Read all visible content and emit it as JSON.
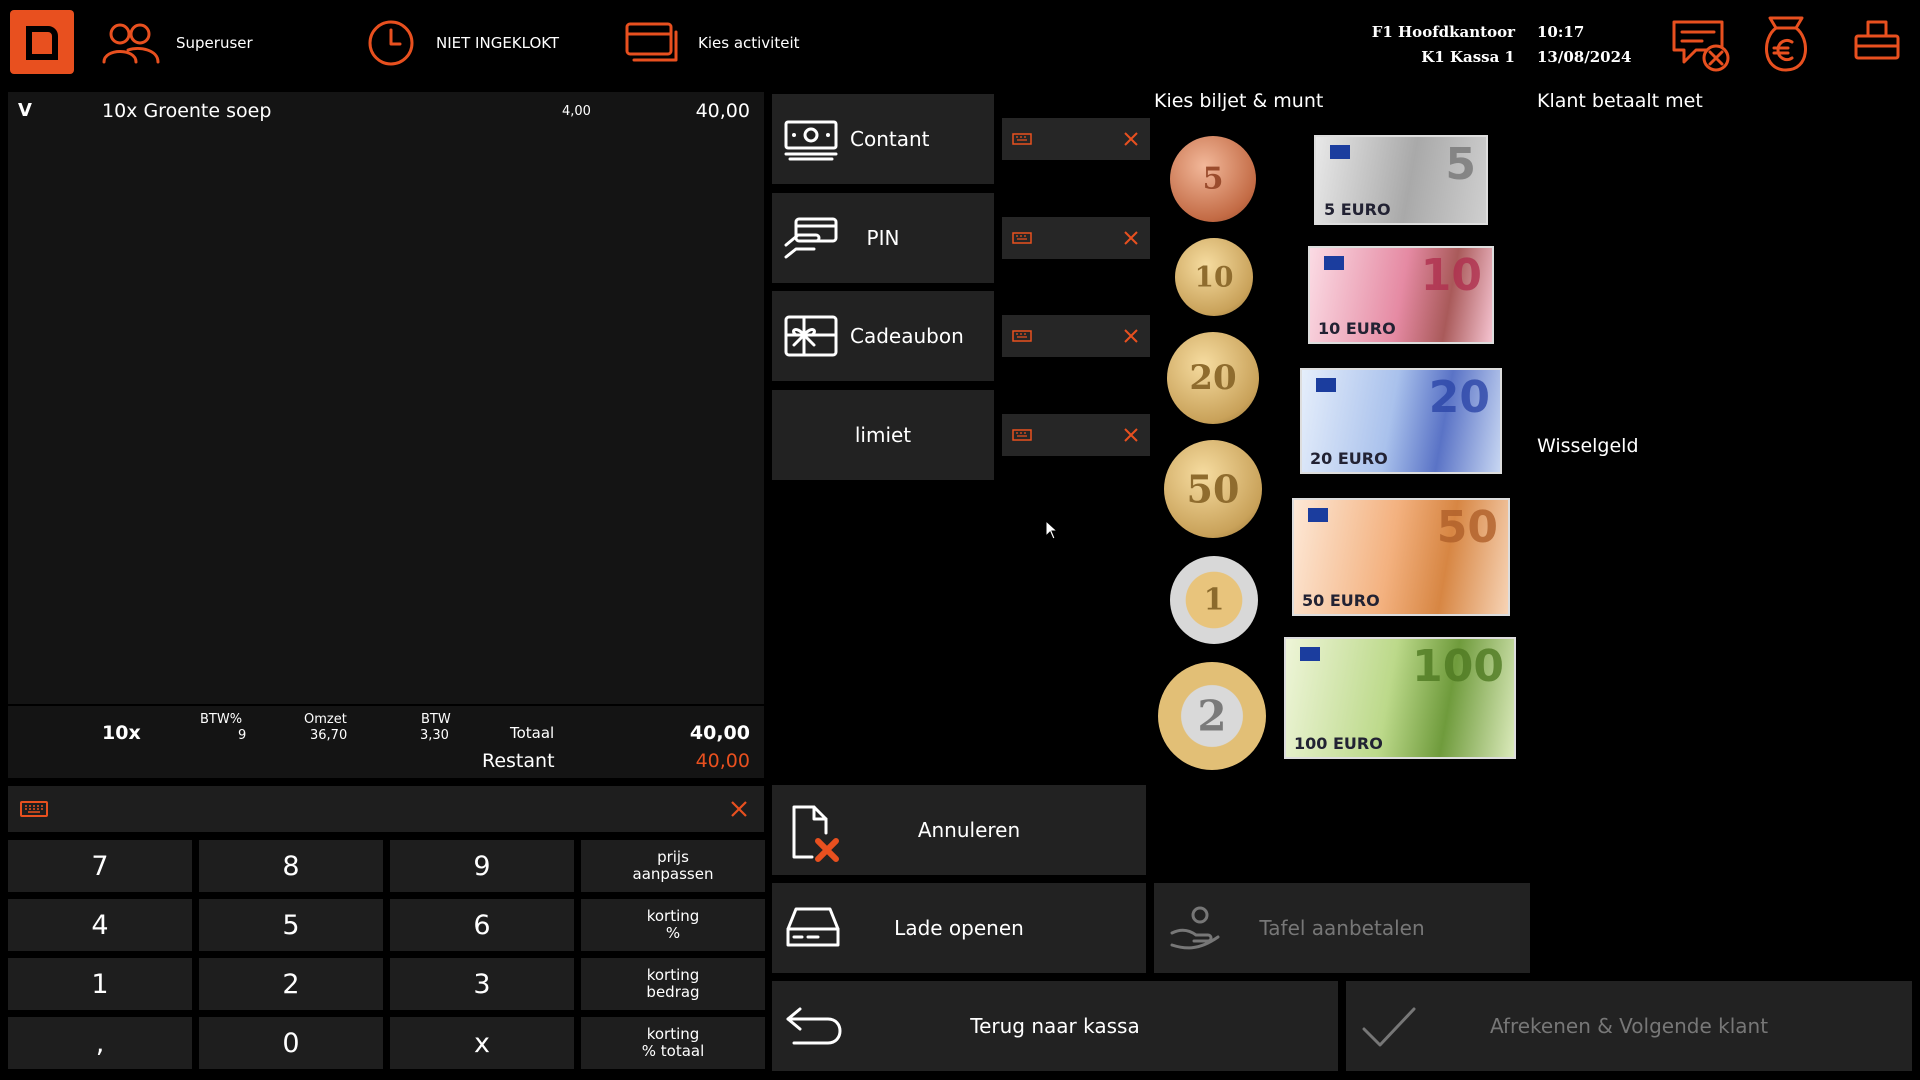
{
  "header": {
    "user": "Superuser",
    "clock_status": "NIET INGEKLOKT",
    "activity": "Kies activiteit",
    "location_line1": "F1 Hoofdkantoor",
    "location_line2": "K1 Kassa 1",
    "time": "10:17",
    "date": "13/08/2024"
  },
  "order": {
    "lines": [
      {
        "flag": "V",
        "description": "10x Groente soep",
        "unit_price": "4,00",
        "amount": "40,00"
      }
    ],
    "summary": {
      "quantity": "10x",
      "btw_pct_label": "BTW%",
      "btw_pct": "9",
      "omzet_label": "Omzet",
      "omzet": "36,70",
      "btw_label": "BTW",
      "btw": "3,30",
      "total_label": "Totaal",
      "total": "40,00",
      "remaining_label": "Restant",
      "remaining": "40,00"
    }
  },
  "keypad": {
    "rows": [
      [
        "7",
        "8",
        "9",
        "prijs\naanpassen"
      ],
      [
        "4",
        "5",
        "6",
        "korting\n%"
      ],
      [
        "1",
        "2",
        "3",
        "korting\nbedrag"
      ],
      [
        ",",
        "0",
        "x",
        "korting\n% totaal"
      ]
    ]
  },
  "payment_methods": [
    {
      "label": "Contant",
      "icon": "cash-icon"
    },
    {
      "label": "PIN",
      "icon": "card-hand-icon"
    },
    {
      "label": "Cadeaubon",
      "icon": "gift-card-icon"
    },
    {
      "label": "limiet",
      "icon": ""
    }
  ],
  "money": {
    "title": "Kies biljet & munt",
    "coins": [
      "5",
      "10",
      "20",
      "50",
      "1",
      "2"
    ],
    "notes": [
      "5",
      "10",
      "20",
      "50",
      "100"
    ],
    "note_currency": "EURO"
  },
  "right": {
    "customer_pays_label": "Klant betaalt met",
    "change_label": "Wisselgeld"
  },
  "actions": {
    "cancel": "Annuleren",
    "open_drawer": "Lade openen",
    "table_prepay": "Tafel aanbetalen",
    "back": "Terug naar kassa",
    "checkout": "Afrekenen & Volgende klant"
  },
  "colors": {
    "accent": "#e8501f",
    "background": "#000000",
    "panel": "#1c1c1c"
  }
}
